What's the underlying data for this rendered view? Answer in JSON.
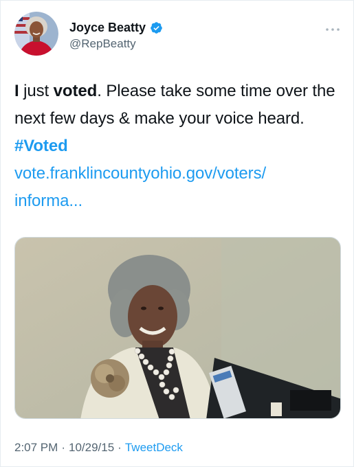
{
  "author": {
    "display_name": "Joyce Beatty",
    "handle": "@RepBeatty",
    "verified": true,
    "avatar_icon": "profile-photo"
  },
  "tweet": {
    "text_part1_bold": "I",
    "text_part2": " just ",
    "text_part3_bold": "voted",
    "text_part4": ". Please take some time over the next few days & make your voice heard. ",
    "hashtag": "#Voted",
    "link_line1": "vote.franklincountyohio.gov/voters/",
    "link_line2": "informa..."
  },
  "media": {
    "description_icon": "photo-woman-at-voting-machine"
  },
  "footer": {
    "time": "2:07 PM",
    "separator": "·",
    "date": "10/29/15",
    "source": "TweetDeck"
  },
  "colors": {
    "link": "#1d9bf0",
    "text": "#0f1419",
    "secondary": "#536471",
    "verified": "#1d9bf0"
  },
  "icons": {
    "verified": "verified-badge-icon",
    "more": "more-options-icon"
  }
}
